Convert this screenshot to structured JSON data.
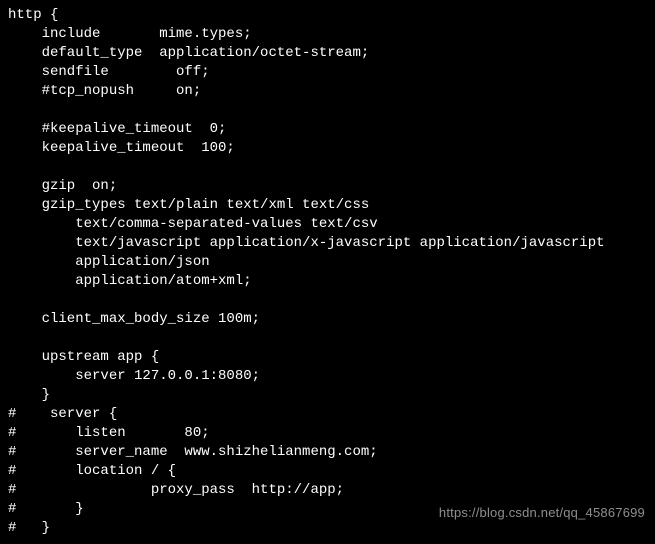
{
  "lines": [
    "http {",
    "    include       mime.types;",
    "    default_type  application/octet-stream;",
    "    sendfile        off;",
    "    #tcp_nopush     on;",
    "",
    "    #keepalive_timeout  0;",
    "    keepalive_timeout  100;",
    "",
    "    gzip  on;",
    "    gzip_types text/plain text/xml text/css",
    "        text/comma-separated-values text/csv",
    "        text/javascript application/x-javascript application/javascript",
    "        application/json",
    "        application/atom+xml;",
    "",
    "    client_max_body_size 100m;",
    "",
    "    upstream app {",
    "        server 127.0.0.1:8080;",
    "    }",
    "#    server {",
    "#       listen       80;",
    "#       server_name  www.shizhelianmeng.com;",
    "#       location / {",
    "#                proxy_pass  http://app;",
    "#       }",
    "#   }"
  ],
  "watermark": "https://blog.csdn.net/qq_45867699"
}
